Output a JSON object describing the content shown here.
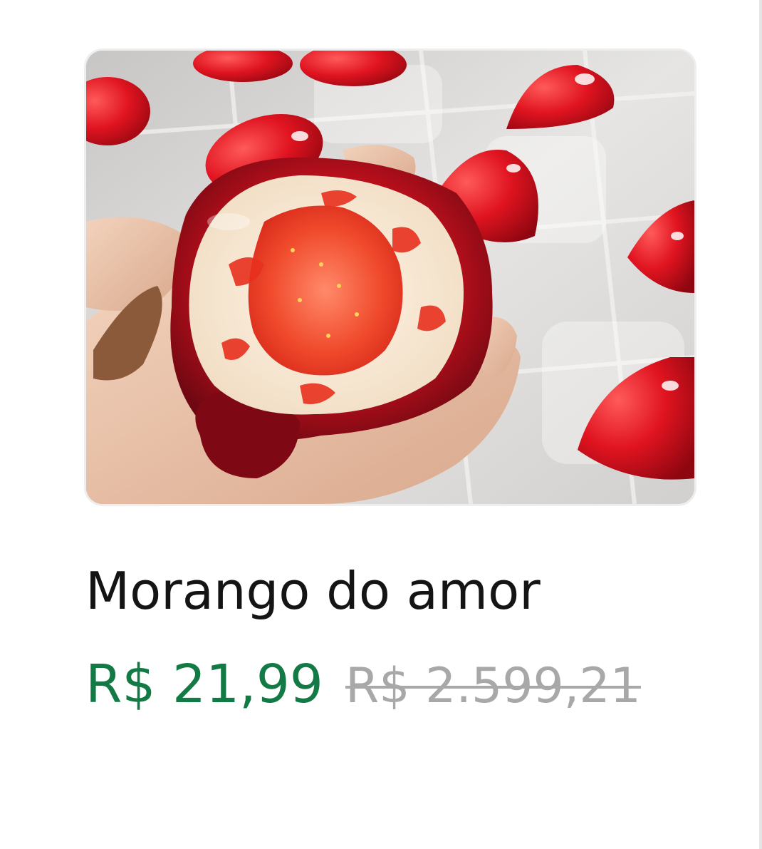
{
  "product": {
    "name": "Morango do amor",
    "price_current": "R$ 21,99",
    "price_original": "R$ 2.599,21",
    "image_alt": "Morango do amor",
    "colors": {
      "price_current": "#137a45",
      "price_original": "#a8a8a8",
      "name": "#141414"
    }
  }
}
